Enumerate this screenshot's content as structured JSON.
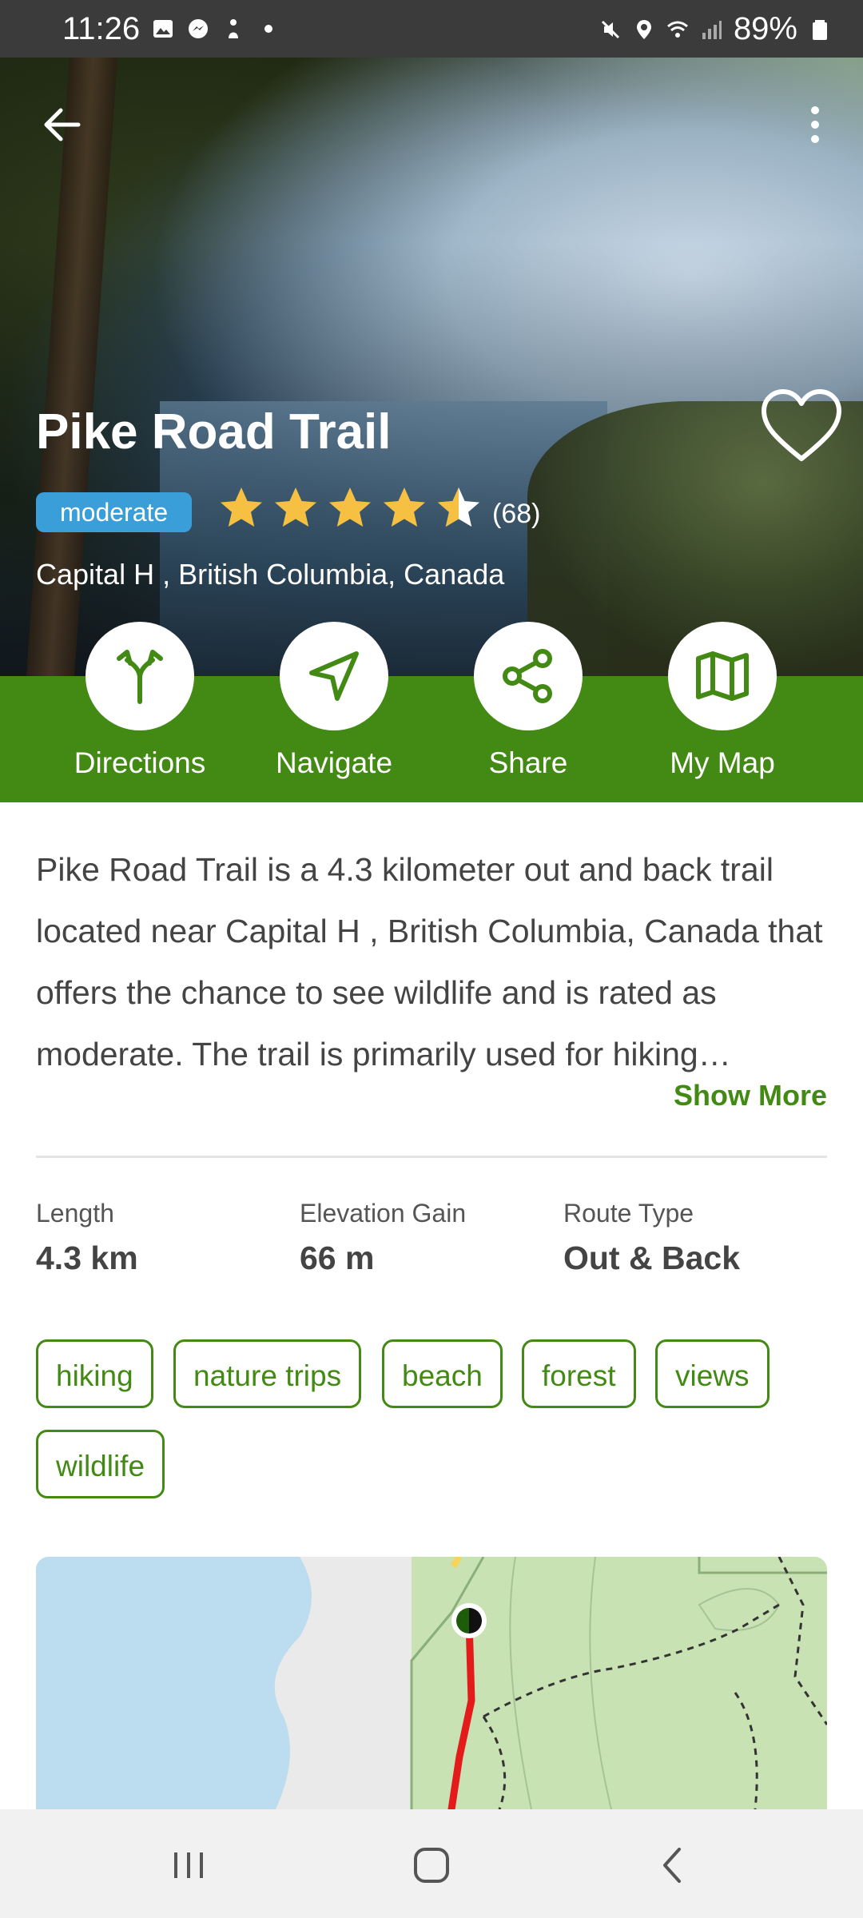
{
  "status_bar": {
    "time": "11:26",
    "battery": "89%"
  },
  "trail": {
    "title": "Pike Road Trail",
    "difficulty": "moderate",
    "rating": 4.5,
    "review_count": "(68)",
    "location": "Capital H , British Columbia, Canada"
  },
  "actions": [
    {
      "label": "Directions",
      "icon": "directions-icon"
    },
    {
      "label": "Navigate",
      "icon": "navigate-icon"
    },
    {
      "label": "Share",
      "icon": "share-icon"
    },
    {
      "label": "My Map",
      "icon": "map-icon"
    }
  ],
  "description": {
    "text": "Pike Road Trail is a 4.3 kilometer out and back trail located near Capital H , British Columbia, Canada that offers the chance to see wildlife and is rated as moderate. The trail is primarily used for hiking…",
    "show_more": "Show More"
  },
  "stats": [
    {
      "label": "Length",
      "value": "4.3 km"
    },
    {
      "label": "Elevation Gain",
      "value": "66 m"
    },
    {
      "label": "Route Type",
      "value": "Out & Back"
    }
  ],
  "tags": [
    "hiking",
    "nature trips",
    "beach",
    "forest",
    "views",
    "wildlife"
  ],
  "colors": {
    "brand_green": "#428a13",
    "badge_blue": "#3a9fd8",
    "star_gold": "#f6c142"
  }
}
